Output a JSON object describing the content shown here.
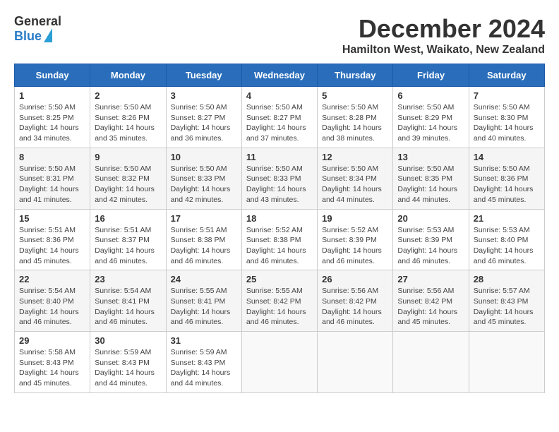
{
  "logo": {
    "line1": "General",
    "line2": "Blue"
  },
  "header": {
    "title": "December 2024",
    "location": "Hamilton West, Waikato, New Zealand"
  },
  "columns": [
    "Sunday",
    "Monday",
    "Tuesday",
    "Wednesday",
    "Thursday",
    "Friday",
    "Saturday"
  ],
  "weeks": [
    [
      {
        "day": "1",
        "sunrise": "5:50 AM",
        "sunset": "8:25 PM",
        "daylight": "14 hours and 34 minutes."
      },
      {
        "day": "2",
        "sunrise": "5:50 AM",
        "sunset": "8:26 PM",
        "daylight": "14 hours and 35 minutes."
      },
      {
        "day": "3",
        "sunrise": "5:50 AM",
        "sunset": "8:27 PM",
        "daylight": "14 hours and 36 minutes."
      },
      {
        "day": "4",
        "sunrise": "5:50 AM",
        "sunset": "8:27 PM",
        "daylight": "14 hours and 37 minutes."
      },
      {
        "day": "5",
        "sunrise": "5:50 AM",
        "sunset": "8:28 PM",
        "daylight": "14 hours and 38 minutes."
      },
      {
        "day": "6",
        "sunrise": "5:50 AM",
        "sunset": "8:29 PM",
        "daylight": "14 hours and 39 minutes."
      },
      {
        "day": "7",
        "sunrise": "5:50 AM",
        "sunset": "8:30 PM",
        "daylight": "14 hours and 40 minutes."
      }
    ],
    [
      {
        "day": "8",
        "sunrise": "5:50 AM",
        "sunset": "8:31 PM",
        "daylight": "14 hours and 41 minutes."
      },
      {
        "day": "9",
        "sunrise": "5:50 AM",
        "sunset": "8:32 PM",
        "daylight": "14 hours and 42 minutes."
      },
      {
        "day": "10",
        "sunrise": "5:50 AM",
        "sunset": "8:33 PM",
        "daylight": "14 hours and 42 minutes."
      },
      {
        "day": "11",
        "sunrise": "5:50 AM",
        "sunset": "8:33 PM",
        "daylight": "14 hours and 43 minutes."
      },
      {
        "day": "12",
        "sunrise": "5:50 AM",
        "sunset": "8:34 PM",
        "daylight": "14 hours and 44 minutes."
      },
      {
        "day": "13",
        "sunrise": "5:50 AM",
        "sunset": "8:35 PM",
        "daylight": "14 hours and 44 minutes."
      },
      {
        "day": "14",
        "sunrise": "5:50 AM",
        "sunset": "8:36 PM",
        "daylight": "14 hours and 45 minutes."
      }
    ],
    [
      {
        "day": "15",
        "sunrise": "5:51 AM",
        "sunset": "8:36 PM",
        "daylight": "14 hours and 45 minutes."
      },
      {
        "day": "16",
        "sunrise": "5:51 AM",
        "sunset": "8:37 PM",
        "daylight": "14 hours and 46 minutes."
      },
      {
        "day": "17",
        "sunrise": "5:51 AM",
        "sunset": "8:38 PM",
        "daylight": "14 hours and 46 minutes."
      },
      {
        "day": "18",
        "sunrise": "5:52 AM",
        "sunset": "8:38 PM",
        "daylight": "14 hours and 46 minutes."
      },
      {
        "day": "19",
        "sunrise": "5:52 AM",
        "sunset": "8:39 PM",
        "daylight": "14 hours and 46 minutes."
      },
      {
        "day": "20",
        "sunrise": "5:53 AM",
        "sunset": "8:39 PM",
        "daylight": "14 hours and 46 minutes."
      },
      {
        "day": "21",
        "sunrise": "5:53 AM",
        "sunset": "8:40 PM",
        "daylight": "14 hours and 46 minutes."
      }
    ],
    [
      {
        "day": "22",
        "sunrise": "5:54 AM",
        "sunset": "8:40 PM",
        "daylight": "14 hours and 46 minutes."
      },
      {
        "day": "23",
        "sunrise": "5:54 AM",
        "sunset": "8:41 PM",
        "daylight": "14 hours and 46 minutes."
      },
      {
        "day": "24",
        "sunrise": "5:55 AM",
        "sunset": "8:41 PM",
        "daylight": "14 hours and 46 minutes."
      },
      {
        "day": "25",
        "sunrise": "5:55 AM",
        "sunset": "8:42 PM",
        "daylight": "14 hours and 46 minutes."
      },
      {
        "day": "26",
        "sunrise": "5:56 AM",
        "sunset": "8:42 PM",
        "daylight": "14 hours and 46 minutes."
      },
      {
        "day": "27",
        "sunrise": "5:56 AM",
        "sunset": "8:42 PM",
        "daylight": "14 hours and 45 minutes."
      },
      {
        "day": "28",
        "sunrise": "5:57 AM",
        "sunset": "8:43 PM",
        "daylight": "14 hours and 45 minutes."
      }
    ],
    [
      {
        "day": "29",
        "sunrise": "5:58 AM",
        "sunset": "8:43 PM",
        "daylight": "14 hours and 45 minutes."
      },
      {
        "day": "30",
        "sunrise": "5:59 AM",
        "sunset": "8:43 PM",
        "daylight": "14 hours and 44 minutes."
      },
      {
        "day": "31",
        "sunrise": "5:59 AM",
        "sunset": "8:43 PM",
        "daylight": "14 hours and 44 minutes."
      },
      null,
      null,
      null,
      null
    ]
  ]
}
